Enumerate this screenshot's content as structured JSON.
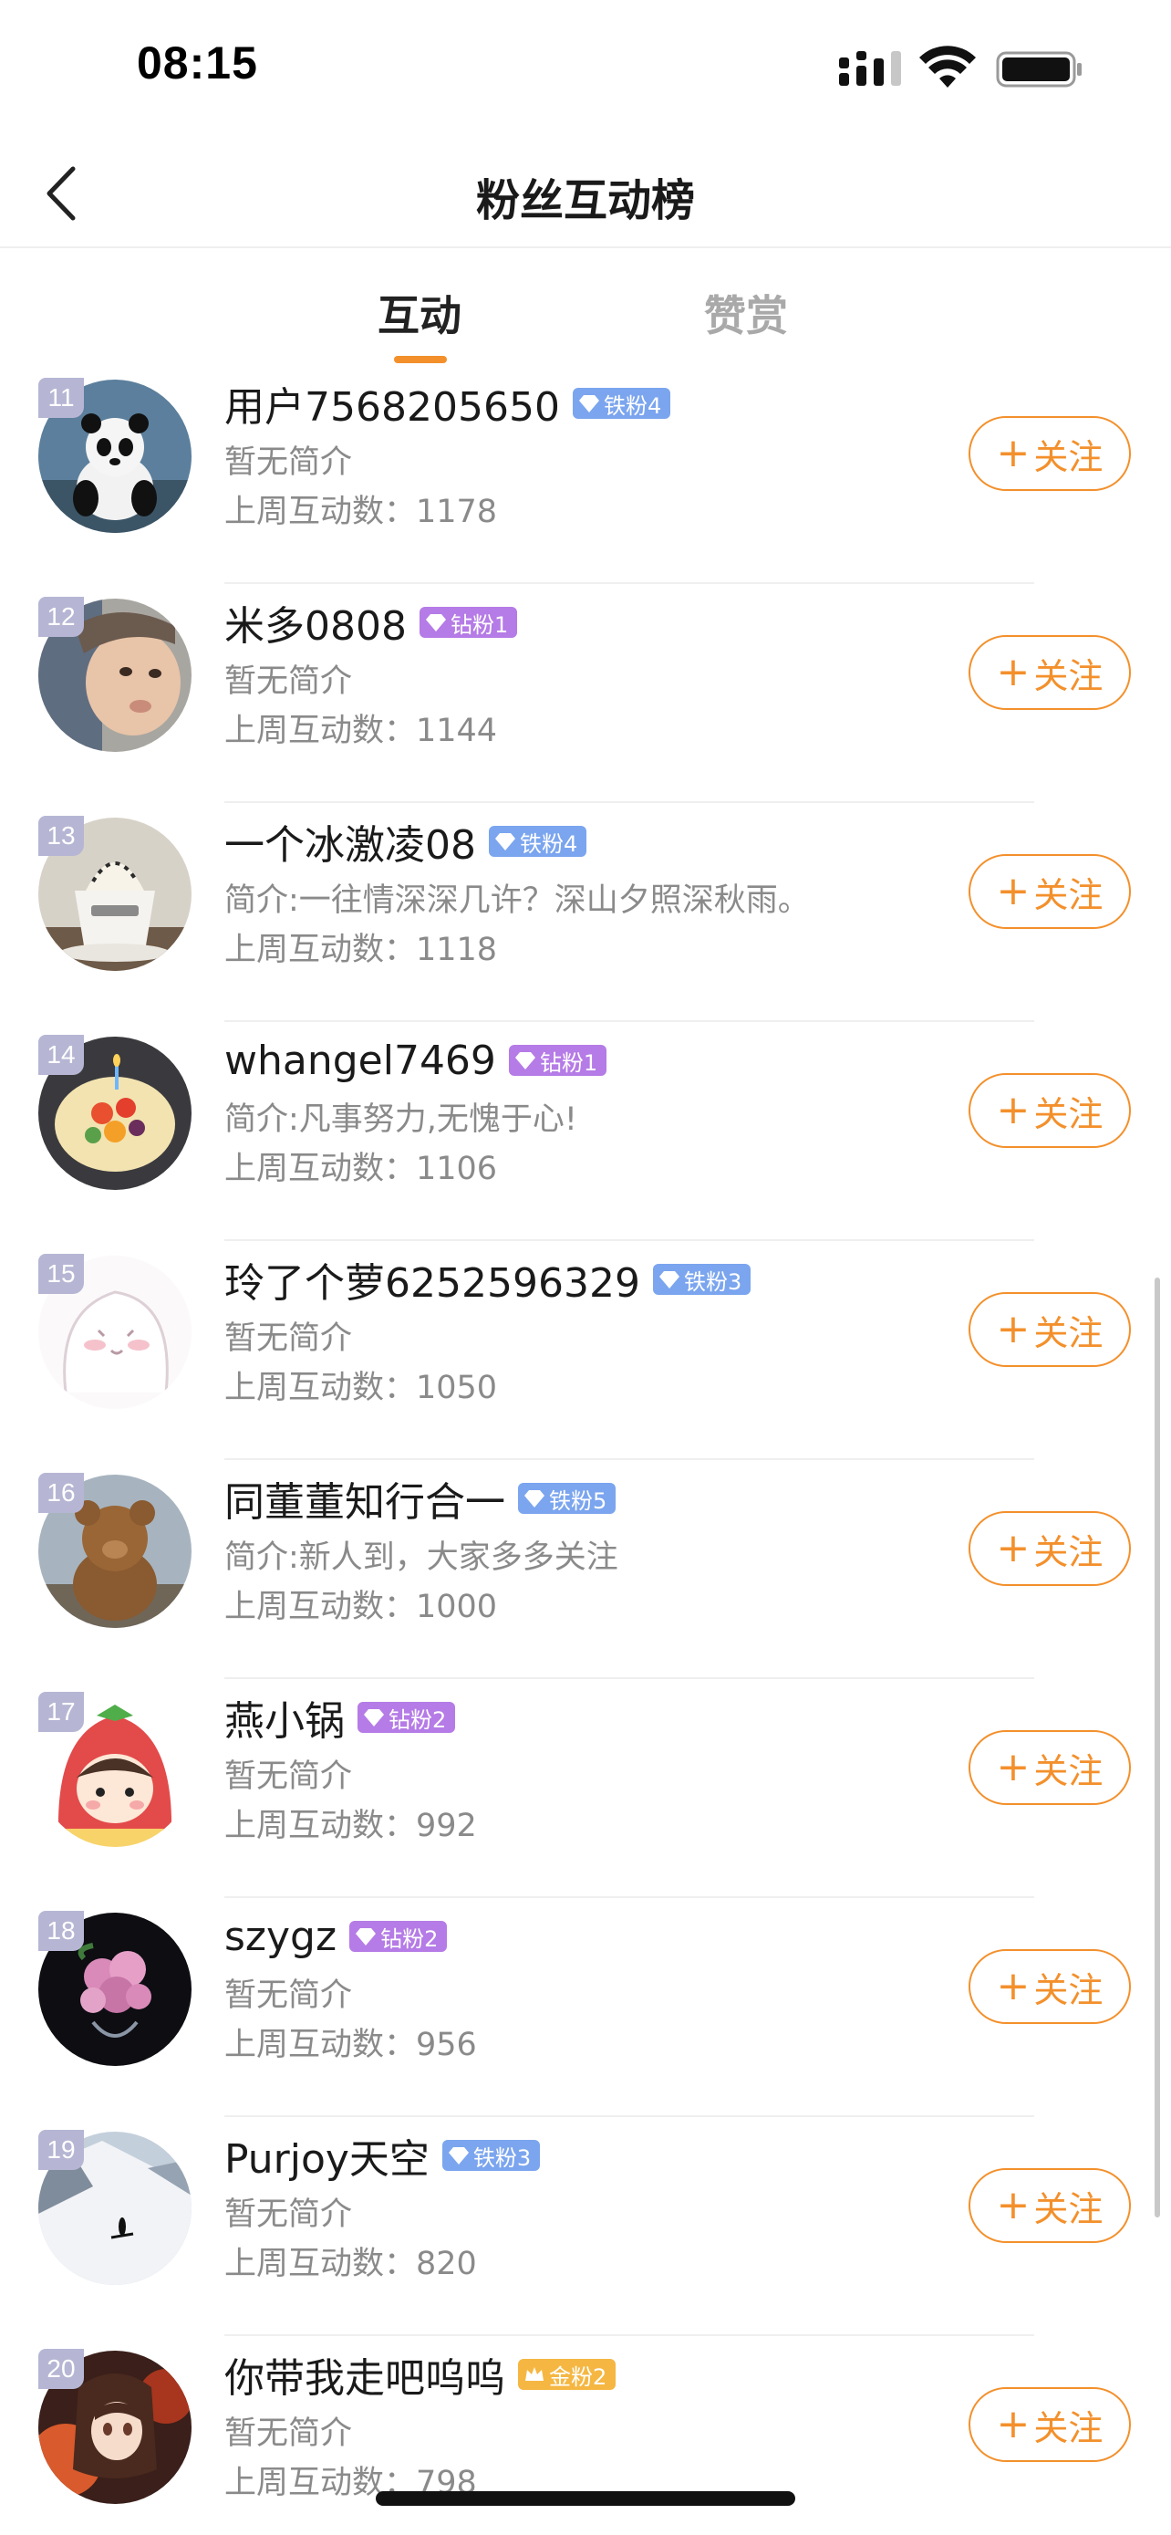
{
  "status_bar": {
    "time": "08:15"
  },
  "nav": {
    "title": "粉丝互动榜"
  },
  "tabs": [
    {
      "label": "互动",
      "active": true
    },
    {
      "label": "赞赏",
      "active": false
    }
  ],
  "follow_label": "关注",
  "colors": {
    "accent": "#f3902c",
    "iron_badge": "#7ba5ee",
    "diamond_badge": "#b57be6",
    "gold_badge": "#f5b742"
  },
  "fans": [
    {
      "rank": "11",
      "name": "用户7568205650",
      "badge": "铁粉4",
      "badge_type": "iron",
      "bio": "暂无简介",
      "count": "上周互动数：1178",
      "avatar": "panda"
    },
    {
      "rank": "12",
      "name": "米多0808",
      "badge": "钻粉1",
      "badge_type": "diamond",
      "bio": "暂无简介",
      "count": "上周互动数：1144",
      "avatar": "baby-photo"
    },
    {
      "rank": "13",
      "name": "一个冰激凌08",
      "badge": "铁粉4",
      "badge_type": "iron",
      "bio": "简介:一往情深深几许？深山夕照深秋雨。",
      "count": "上周互动数：1118",
      "avatar": "coffee-cup"
    },
    {
      "rank": "14",
      "name": "whangel7469",
      "badge": "钻粉1",
      "badge_type": "diamond",
      "bio": "简介:凡事努力,无愧于心!",
      "count": "上周互动数：1106",
      "avatar": "fruit-cake"
    },
    {
      "rank": "15",
      "name": "玲了个萝6252596329",
      "badge": "铁粉3",
      "badge_type": "iron",
      "bio": "暂无简介",
      "count": "上周互动数：1050",
      "avatar": "ghost-sketch"
    },
    {
      "rank": "16",
      "name": "同董董知行合一",
      "badge": "铁粉5",
      "badge_type": "iron",
      "bio": "简介:新人到，大家多多关注",
      "count": "上周互动数：1000",
      "avatar": "teddy-bear"
    },
    {
      "rank": "17",
      "name": "燕小锅",
      "badge": "钻粉2",
      "badge_type": "diamond",
      "bio": "暂无简介",
      "count": "上周互动数：992",
      "avatar": "strawberry-girl"
    },
    {
      "rank": "18",
      "name": "szygz",
      "badge": "钻粉2",
      "badge_type": "diamond",
      "bio": "暂无简介",
      "count": "上周互动数：956",
      "avatar": "rose-vase"
    },
    {
      "rank": "19",
      "name": "Purjoy天空",
      "badge": "铁粉3",
      "badge_type": "iron",
      "bio": "暂无简介",
      "count": "上周互动数：820",
      "avatar": "snow-skier"
    },
    {
      "rank": "20",
      "name": "你带我走吧呜呜",
      "badge": "金粉2",
      "badge_type": "gold",
      "bio": "暂无简介",
      "count": "上周互动数：798",
      "avatar": "anime-girl"
    }
  ]
}
